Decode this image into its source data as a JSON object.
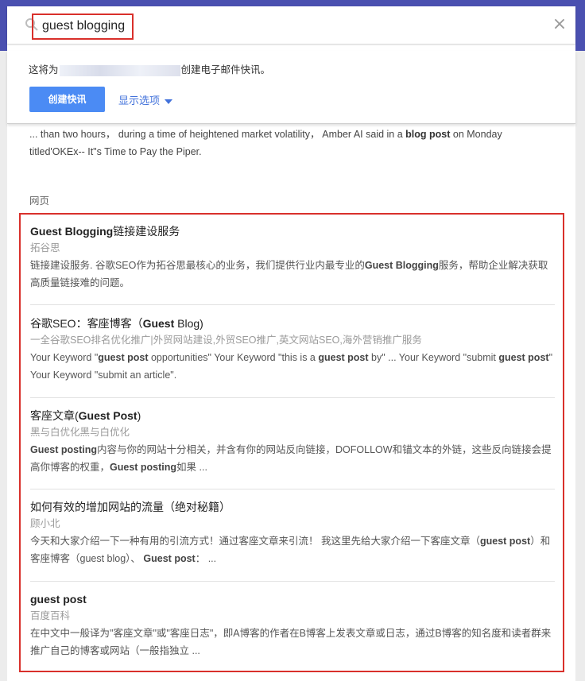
{
  "search": {
    "query": "guest blogging",
    "clear_symbol": "×"
  },
  "alert": {
    "text_before": "这将为",
    "text_after": "创建电子邮件快讯。",
    "create_button": "创建快讯",
    "options_link": "显示选项"
  },
  "news_snippet": {
    "part1": "... than two hours， during a time of heightened market volatility， Amber AI said in a ",
    "bold1": "blog post",
    "part2": " on Monday titled'OKEx-- It\"s Time to Pay the Piper."
  },
  "section_label": "网页",
  "results": [
    {
      "title_bold": "Guest Blogging",
      "title_rest": "链接建设服务",
      "source": "拓谷思",
      "desc_a": "链接建设服务. 谷歌SEO作为拓谷思最核心的业务，我们提供行业内最专业的",
      "desc_b": "Guest Blogging",
      "desc_c": "服务，帮助企业解决获取高质量链接难的问题。"
    },
    {
      "title_pre": "谷歌SEO：客座博客（",
      "title_bold": "Guest",
      "title_rest": " Blog)",
      "source": "一全谷歌SEO排名优化推广|外贸网站建设,外贸SEO推广,英文网站SEO,海外营销推广服务",
      "desc_a": "Your Keyword \"",
      "desc_b": "guest post",
      "desc_c": " opportunities\" Your Keyword \"this is a ",
      "desc_d": "guest post",
      "desc_e": " by\" ... Your Keyword \"submit ",
      "desc_f": "guest post",
      "desc_g": "\" Your Keyword \"submit an article\"."
    },
    {
      "title_pre": "客座文章(",
      "title_bold": "Guest Post",
      "title_rest": ")",
      "source": "黑与白优化黑与白优化",
      "desc_a": "Guest posting",
      "desc_b": "内容与你的网站十分相关，并含有你的网站反向链接，DOFOLLOW和锚文本的外链，这些反向链接会提高你博客的权重，",
      "desc_c": "Guest posting",
      "desc_d": "如果 ..."
    },
    {
      "title": "如何有效的增加网站的流量（绝对秘籍）",
      "source": "顾小北",
      "desc_a": "今天和大家介绍一下一种有用的引流方式！通过客座文章来引流！ 我这里先给大家介绍一下客座文章（",
      "desc_b": "guest post",
      "desc_c": "）和客座博客（guest blog）、 ",
      "desc_d": "Guest post",
      "desc_e": "： ..."
    },
    {
      "title_bold": "guest post",
      "source": "百度百科",
      "desc_a": "在中文中一般译为\"客座文章\"或\"客座日志\"，即A博客的作者在B博客上发表文章或日志，通过B博客的知名度和读者群来推广自己的博客或网站（一般指独立 ..."
    }
  ],
  "colors": {
    "topbar": "#4a50b0",
    "accent_button": "#4b8bf4",
    "link": "#4272db",
    "highlight_border": "#d9302b"
  }
}
